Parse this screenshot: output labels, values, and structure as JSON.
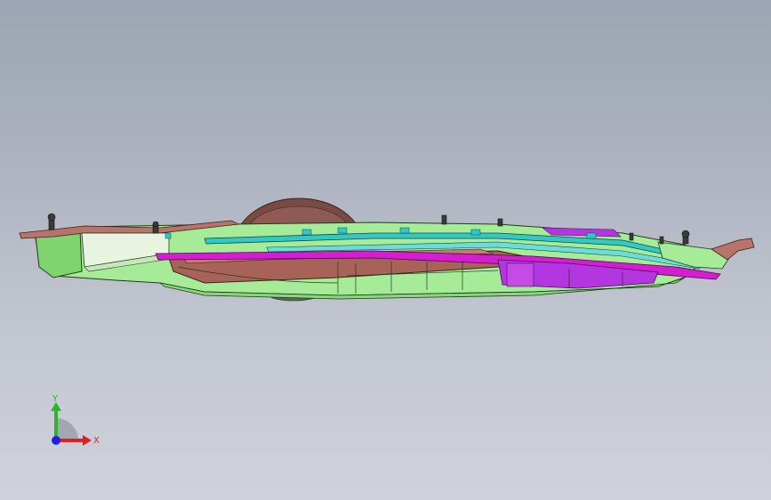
{
  "viewport": {
    "background_top": "#9ca5b3",
    "background_bottom": "#cfd2da"
  },
  "model": {
    "part_colors": {
      "housing": "#a6ec98",
      "housing_dark": "#6bbd60",
      "motor": "#7a4a45",
      "tray": "#a86358",
      "cyan_rail": "#35c8c2",
      "magenta_strip": "#d21fd0",
      "purple_block": "#b436e0",
      "outline": "#1f3a1f"
    }
  },
  "triad": {
    "y_label": "Y",
    "x_label": "X",
    "y_color": "#2bb52b",
    "x_color": "#e02020",
    "z_color": "#2020e0"
  }
}
